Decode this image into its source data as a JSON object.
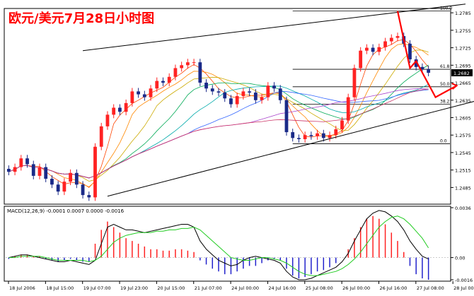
{
  "chart_title": "欧元/美元7月28日小时图",
  "colors": {
    "bull": "#ff2222",
    "bear": "#1a2a88",
    "title": "#ff0000",
    "channel": "#000000",
    "forecast": "#ff0000",
    "fib": "#000000",
    "macd_pos": "#ff2222",
    "macd_neg": "#2222cc",
    "macd_main": "#000000",
    "macd_signal": "#22cc22",
    "current_price_bg": "#000000"
  },
  "chart_data": [
    {
      "type": "candlestick",
      "title": "欧元/美元7月28日小时图",
      "ylim": [
        1.246,
        1.279
      ],
      "y_ticks": [
        "1.2785",
        "1.2755",
        "1.2725",
        "1.2695",
        "1.2665",
        "1.2635",
        "1.2605",
        "1.2575",
        "1.2545",
        "1.2515",
        "1.2485"
      ],
      "x_ticks": [
        "18 Jul 2006",
        "18 Jul 15:00",
        "19 Jul 07:00",
        "19 Jul 23:00",
        "20 Jul 15:00",
        "21 Jul 07:00",
        "24 Jul 00:00",
        "24 Jul 16:00",
        "25 Jul 08:00",
        "26 Jul 00:00",
        "26 Jul 16:00",
        "27 Jul 08:00",
        "28 Jul 00:00"
      ],
      "current_price": "1.2682",
      "fibonacci": [
        {
          "label": "100.0",
          "price": 1.2788
        },
        {
          "label": "61.8",
          "price": 1.2688
        },
        {
          "label": "50.0",
          "price": 1.2658
        },
        {
          "label": "38.2",
          "price": 1.2628
        },
        {
          "label": "0.0",
          "price": 1.256
        }
      ],
      "channel_lines": [
        {
          "from": {
            "bar": 12,
            "price": 1.272
          },
          "to": {
            "bar": 74,
            "price": 1.28
          }
        },
        {
          "from": {
            "bar": 16,
            "price": 1.247
          },
          "to": {
            "bar": 78,
            "price": 1.264
          }
        }
      ],
      "bars_per_x_tick": 6,
      "closes": [
        1.2512,
        1.252,
        1.2535,
        1.2525,
        1.2505,
        1.252,
        1.25,
        1.249,
        1.2478,
        1.2495,
        1.251,
        1.249,
        1.2472,
        1.2468,
        1.2555,
        1.259,
        1.261,
        1.2622,
        1.2615,
        1.263,
        1.265,
        1.2645,
        1.264,
        1.2655,
        1.2668,
        1.2665,
        1.2675,
        1.269,
        1.2695,
        1.27,
        1.27,
        1.2665,
        1.2655,
        1.265,
        1.2648,
        1.2638,
        1.2628,
        1.2642,
        1.265,
        1.2648,
        1.2635,
        1.264,
        1.266,
        1.2655,
        1.2635,
        1.258,
        1.257,
        1.2568,
        1.2575,
        1.2573,
        1.2578,
        1.257,
        1.2575,
        1.2585,
        1.26,
        1.264,
        1.269,
        1.272,
        1.2725,
        1.2718,
        1.2726,
        1.2736,
        1.2742,
        1.2745,
        1.2732,
        1.2705,
        1.2692,
        1.2688,
        1.2682
      ],
      "indicators": [
        "Moving average ribbon",
        "Fibonacci retracement",
        "Ascending channel",
        "Forecast zigzag"
      ]
    },
    {
      "type": "bar",
      "title": "",
      "indicator_label": "MACD(12,26,9) -0.0001 0.0007 0.0000 -0.0016",
      "ylim": [
        -0.0016,
        0.0036
      ],
      "y_ticks": [
        "0.0036",
        "0.00",
        "-0.0016"
      ],
      "histogram": [
        -0.0001,
        0.0001,
        0.0002,
        0.0002,
        0.0001,
        0.0001,
        -0.0001,
        -0.0002,
        -0.0003,
        -0.0002,
        -0.0001,
        -0.0002,
        -0.0003,
        -0.0003,
        0.001,
        0.002,
        0.0026,
        0.0022,
        0.0018,
        0.0014,
        0.0012,
        0.001,
        0.0008,
        0.0006,
        0.0006,
        0.0005,
        0.0005,
        0.0006,
        0.0006,
        0.0005,
        0.0004,
        -0.0002,
        -0.0005,
        -0.0008,
        -0.001,
        -0.0012,
        -0.0012,
        -0.001,
        -0.0008,
        -0.0006,
        -0.0006,
        -0.0004,
        -0.0002,
        -0.0001,
        -0.0002,
        -0.0008,
        -0.0013,
        -0.0015,
        -0.0014,
        -0.0012,
        -0.001,
        -0.0009,
        -0.0007,
        -0.0004,
        0.0,
        0.0006,
        0.0014,
        0.0022,
        0.0028,
        0.003,
        0.0028,
        0.0024,
        0.0018,
        0.0012,
        0.0004,
        -0.0006,
        -0.0012,
        -0.0015,
        -0.0016
      ],
      "macd_line": [
        0.0,
        0.0001,
        0.0002,
        0.0002,
        0.0001,
        0.0,
        -0.0001,
        -0.0002,
        -0.0003,
        -0.0003,
        -0.0002,
        -0.0003,
        -0.0004,
        -0.0005,
        -0.0002,
        0.001,
        0.0022,
        0.0024,
        0.0022,
        0.002,
        0.002,
        0.0019,
        0.0018,
        0.0019,
        0.002,
        0.0021,
        0.0022,
        0.0023,
        0.0024,
        0.0024,
        0.0022,
        0.0012,
        0.0006,
        0.0002,
        -0.0002,
        -0.0004,
        -0.0006,
        -0.0005,
        -0.0002,
        0.0,
        0.0001,
        0.0,
        -0.0001,
        -0.0002,
        -0.0004,
        -0.001,
        -0.0014,
        -0.0016,
        -0.0016,
        -0.0015,
        -0.0013,
        -0.0011,
        -0.0009,
        -0.0007,
        -0.0003,
        0.0003,
        0.0012,
        0.002,
        0.0028,
        0.0032,
        0.0034,
        0.0033,
        0.003,
        0.0026,
        0.002,
        0.0012,
        0.0006,
        0.0001,
        -0.0001
      ],
      "signal_line": [
        0.0,
        0.0,
        0.0001,
        0.0001,
        0.0001,
        0.0001,
        0.0,
        -0.0001,
        -0.0002,
        -0.0002,
        -0.0002,
        -0.0002,
        -0.0002,
        -0.0003,
        -0.0002,
        0.0001,
        0.0006,
        0.0011,
        0.0014,
        0.0016,
        0.0017,
        0.0018,
        0.0018,
        0.0018,
        0.0019,
        0.0019,
        0.002,
        0.002,
        0.0021,
        0.0021,
        0.0022,
        0.002,
        0.0016,
        0.0012,
        0.0008,
        0.0004,
        0.0,
        -0.0001,
        -0.0002,
        -0.0002,
        -0.0001,
        0.0,
        0.0,
        -0.0001,
        -0.0002,
        -0.0004,
        -0.0007,
        -0.001,
        -0.0012,
        -0.0013,
        -0.0013,
        -0.0012,
        -0.0011,
        -0.001,
        -0.0008,
        -0.0005,
        -0.0001,
        0.0004,
        0.001,
        0.0016,
        0.0022,
        0.0026,
        0.0029,
        0.003,
        0.0028,
        0.0024,
        0.0019,
        0.0014,
        0.0007
      ]
    }
  ]
}
